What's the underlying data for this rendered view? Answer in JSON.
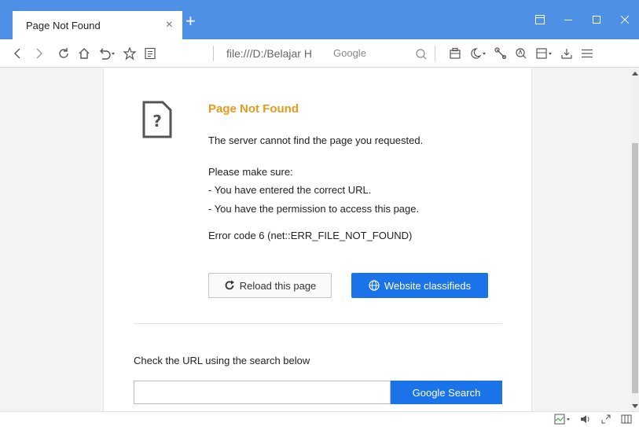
{
  "tab": {
    "title": "Page Not Found",
    "close": "×",
    "new_tab": "+"
  },
  "window_controls": [
    "restore-icon",
    "minimize-icon",
    "maximize-icon",
    "close-icon"
  ],
  "toolbar": {
    "address": "file:///D:/Belajar H",
    "search_engine": "Google"
  },
  "error": {
    "title": "Page Not Found",
    "message": "The server cannot find the page you requested.",
    "make_sure": "Please make sure:",
    "tip1": "- You have entered the correct URL.",
    "tip2": "- You have the permission to access this page.",
    "code": "Error code 6 (net::ERR_FILE_NOT_FOUND)",
    "reload_label": "Reload this page",
    "classifieds_label": "Website classifieds"
  },
  "search": {
    "hint": "Check the URL using the search below",
    "button": "Google Search",
    "value": ""
  },
  "colors": {
    "tabbar": "#4d90e6",
    "accent": "#1a73e8",
    "title": "#e69a1d"
  }
}
